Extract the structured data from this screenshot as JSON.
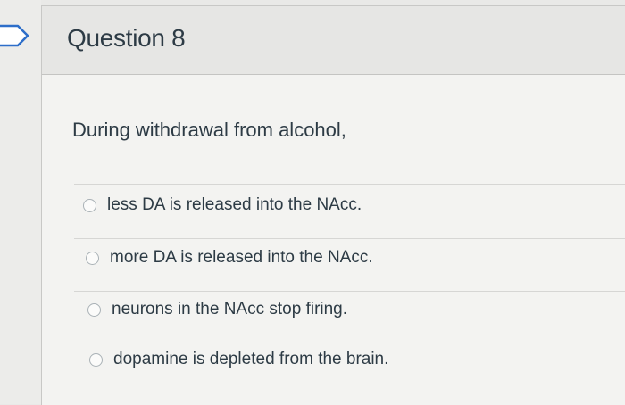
{
  "question": {
    "title": "Question 8",
    "prompt": "During withdrawal from alcohol,"
  },
  "answers": [
    {
      "label": "less DA is released into the NAcc."
    },
    {
      "label": "more DA is released into the NAcc."
    },
    {
      "label": "neurons in the NAcc stop firing."
    },
    {
      "label": "dopamine is depleted from the brain."
    }
  ],
  "icons": {
    "flag": "flag-icon",
    "radio": "radio-unselected-icon"
  }
}
